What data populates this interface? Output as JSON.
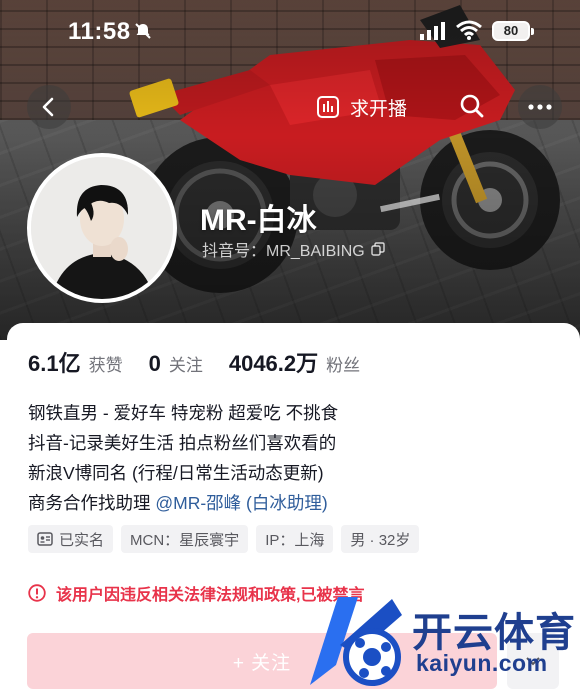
{
  "status_bar": {
    "time": "11:58",
    "battery": "80",
    "icons": [
      "mute-icon",
      "signal-icon",
      "wifi-icon",
      "battery-icon"
    ]
  },
  "nav": {
    "back_icon": "chevron-left-icon",
    "live_label": "求开播",
    "live_icon": "bar-chart-icon",
    "search_icon": "search-icon",
    "more_icon": "ellipsis-icon"
  },
  "profile": {
    "nickname": "MR-白冰",
    "douyin_id": "抖音号：MR_BAIBING",
    "avatar_icon": "avatar-photo"
  },
  "stats": [
    {
      "value": "6.1亿",
      "label": "获赞"
    },
    {
      "value": "0",
      "label": "关注"
    },
    {
      "value": "4046.2万",
      "label": "粉丝"
    }
  ],
  "bio": {
    "line1": "钢铁直男 - 爱好车 特宠粉 超爱吃 不挑食",
    "line2": "抖音-记录美好生活 拍点粉丝们喜欢看的",
    "line3": "新浪V博同名 (行程/日常生活动态更新)",
    "line4_prefix": "商务合作找助理 ",
    "line4_link": "@MR-邵峰 (白冰助理)"
  },
  "tags": [
    {
      "label": "已实名",
      "icon": "id-card-icon"
    },
    {
      "label": "MCN：星辰寰宇"
    },
    {
      "label": "IP：上海"
    },
    {
      "label": "男 · 32岁"
    }
  ],
  "warning": "该用户因违反相关法律法规和政策,已被禁言",
  "follow_button": "+ 关注",
  "watermark": {
    "brand": "开云体育",
    "url": "kaiyun.com"
  },
  "colors": {
    "accent_pink": "#fbd3d8",
    "warning_red": "#e8334a",
    "link_blue": "#2f5d9b",
    "watermark_blue": "#1f3f8f"
  }
}
